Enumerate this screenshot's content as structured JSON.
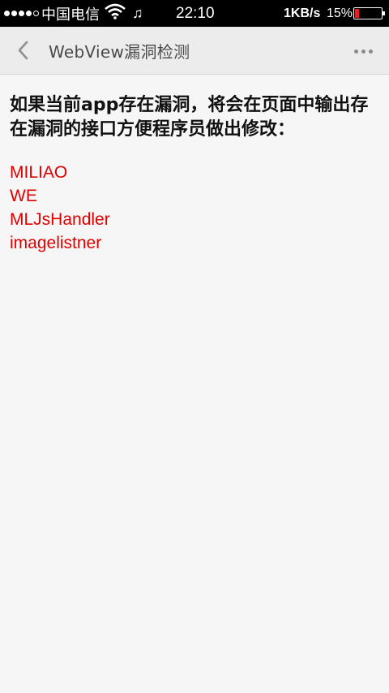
{
  "status_bar": {
    "carrier": "中国电信",
    "time": "22:10",
    "net_speed": "1KB/s",
    "battery_percent": "15%",
    "battery_level": 0.15,
    "icons": [
      "signal-icon",
      "wifi-icon",
      "music-icon",
      "battery-icon"
    ]
  },
  "header": {
    "title": "WebView漏洞检测",
    "back_icon": "chevron-left-icon",
    "more_icon": "more-horizontal-icon"
  },
  "main": {
    "intro": "如果当前app存在漏洞，将会在页面中输出存在漏洞的接口方便程序员做出修改：",
    "vulnerable_interfaces": [
      "MILIAO",
      "WE",
      "MLJsHandler",
      "imagelistner"
    ]
  },
  "colors": {
    "status_bar_bg": "#000000",
    "title_bar_bg": "#ececec",
    "page_bg": "#f6f6f6",
    "interface_text": "#e00000",
    "battery_low": "#e02020"
  }
}
